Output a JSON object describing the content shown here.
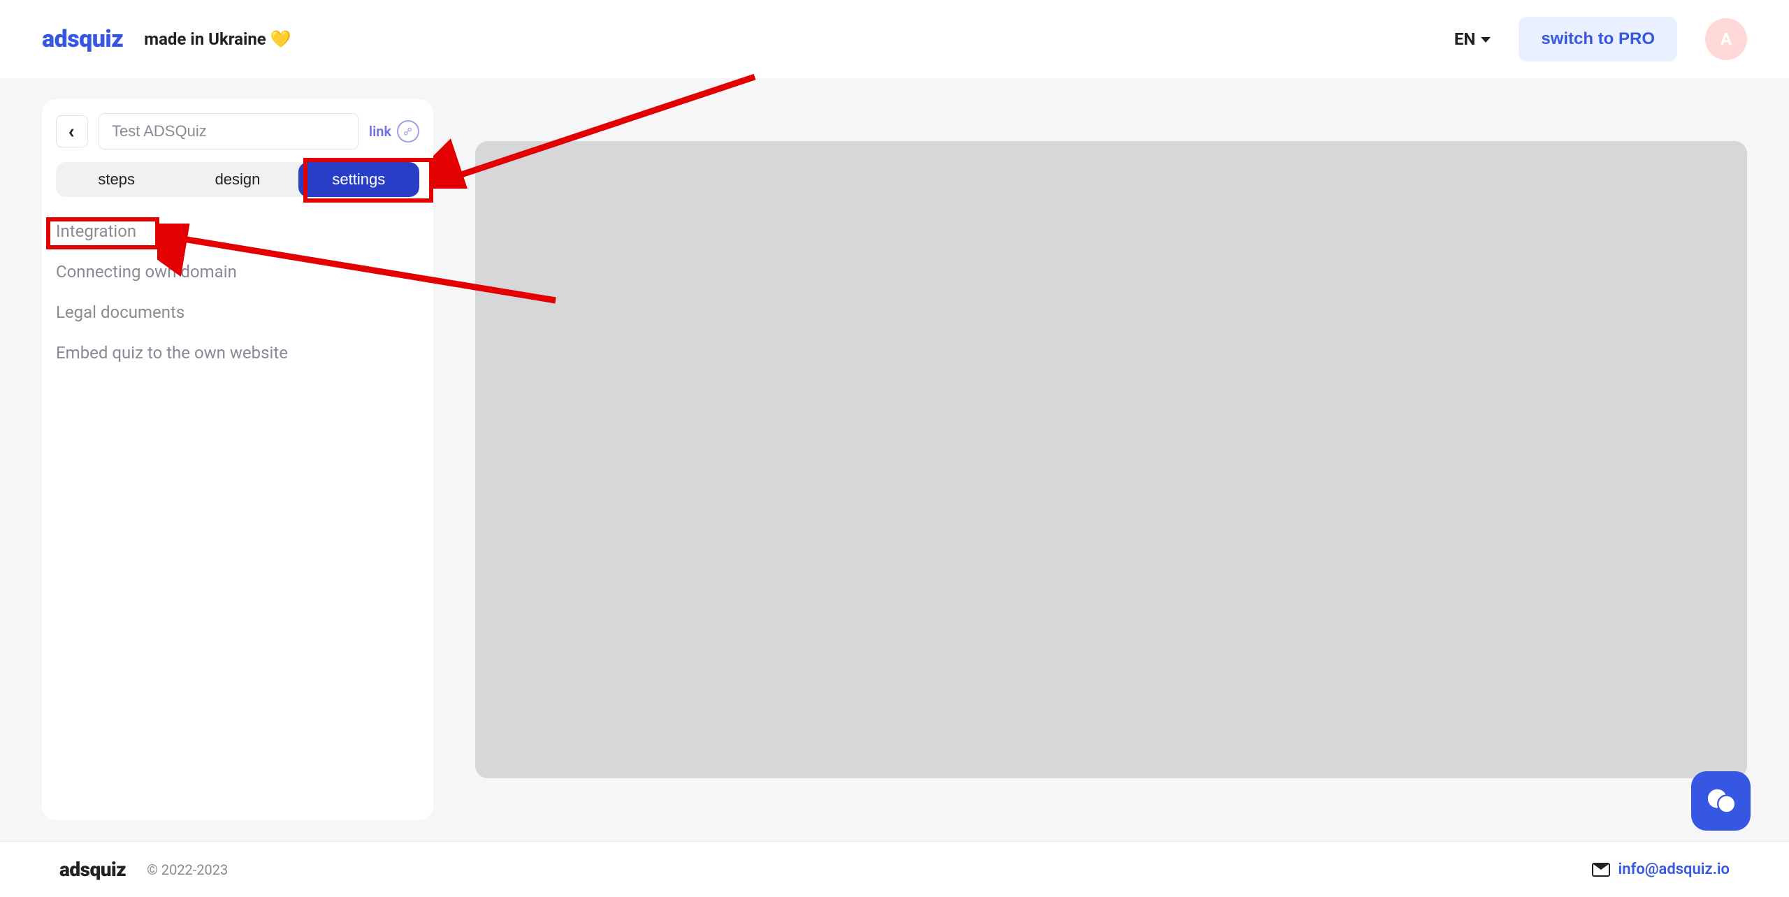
{
  "header": {
    "brand": "adsquiz",
    "tagline": "made in Ukraine 💛",
    "lang": "EN",
    "switch_pro": "switch to PRO",
    "avatar_initial": "A"
  },
  "sidebar": {
    "back_glyph": "‹",
    "title_value": "Test ADSQuiz",
    "link_label": "link",
    "tabs": [
      {
        "label": "steps",
        "active": false
      },
      {
        "label": "design",
        "active": false
      },
      {
        "label": "settings",
        "active": true
      }
    ],
    "settings_items": [
      "Integration",
      "Connecting own domain",
      "Legal documents",
      "Embed quiz to the own website"
    ]
  },
  "footer": {
    "brand": "adsquiz",
    "copyright": "© 2022-2023",
    "email": "info@adsquiz.io"
  }
}
